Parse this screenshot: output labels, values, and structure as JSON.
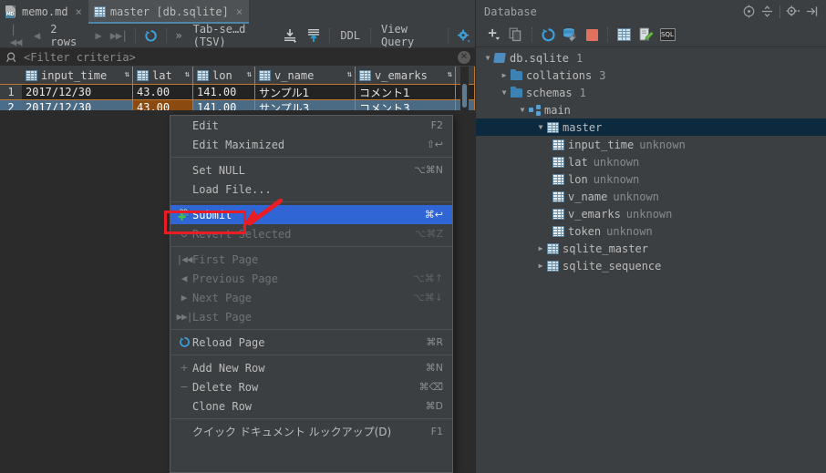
{
  "editor": {
    "tabs": [
      {
        "label": "memo.md",
        "icon": "markdown-file-icon",
        "active": false,
        "close": "×"
      },
      {
        "label": "master [db.sqlite]",
        "icon": "table-icon",
        "active": true,
        "close": "×"
      }
    ],
    "toolbar": {
      "first_page_icon": "first-page-icon",
      "prev_page_icon": "previous-page-icon",
      "rows_label": "2 rows",
      "next_page_icon": "next-page-icon",
      "last_page_icon": "last-page-icon",
      "reload_icon": "reload-icon",
      "chevrons_icon": "expand-chevrons-icon",
      "format_label": "Tab-se…d (TSV)",
      "dump_icon": "dump-data-icon",
      "upload_icon": "upload-data-icon",
      "ddl_label": "DDL",
      "view_query_label": "View Query",
      "settings_icon": "gear-icon"
    },
    "filter": {
      "icon": "search-icon",
      "placeholder": "<Filter criteria>",
      "clear_icon": "clear-icon"
    },
    "grid": {
      "columns": [
        {
          "name": "input_time",
          "icon": "column-icon",
          "sorter": "⇅"
        },
        {
          "name": "lat",
          "icon": "column-icon",
          "sorter": "⇅"
        },
        {
          "name": "lon",
          "icon": "column-icon",
          "sorter": "⇅"
        },
        {
          "name": "v_name",
          "icon": "column-icon",
          "sorter": "⇅"
        },
        {
          "name": "v_emarks",
          "icon": "column-icon",
          "sorter": "⇅"
        }
      ],
      "rows": [
        {
          "num": "1",
          "input_time": "2017/12/30",
          "lat": "43.00",
          "lon": "141.00",
          "v_name": "サンプル1",
          "v_emarks": "コメント1"
        },
        {
          "num": "2",
          "input_time": "2017/12/30",
          "lat": "43.00",
          "lon": "141.00",
          "v_name": "サンプル3",
          "v_emarks": "コメント3"
        }
      ]
    }
  },
  "context_menu": {
    "items": [
      {
        "label": "Edit",
        "shortcut": "F2",
        "icon": "",
        "state": "normal"
      },
      {
        "label": "Edit Maximized",
        "shortcut": "⇧↩",
        "icon": "",
        "state": "normal"
      },
      {
        "type": "separator"
      },
      {
        "label": "Set NULL",
        "shortcut": "⌥⌘N",
        "icon": "",
        "state": "normal"
      },
      {
        "label": "Load File...",
        "shortcut": "",
        "icon": "",
        "state": "normal"
      },
      {
        "type": "separator"
      },
      {
        "label": "Submit",
        "shortcut": "⌘↩",
        "icon": "db-submit-icon",
        "state": "selected"
      },
      {
        "label": "Revert Selected",
        "shortcut": "⌥⌘Z",
        "icon": "revert-icon",
        "state": "disabled"
      },
      {
        "type": "separator"
      },
      {
        "label": "First Page",
        "shortcut": "",
        "icon": "first-page-icon",
        "state": "disabled"
      },
      {
        "label": "Previous Page",
        "shortcut": "⌥⌘↑",
        "icon": "previous-page-icon",
        "state": "disabled"
      },
      {
        "label": "Next Page",
        "shortcut": "⌥⌘↓",
        "icon": "next-page-icon",
        "state": "disabled"
      },
      {
        "label": "Last Page",
        "shortcut": "",
        "icon": "last-page-icon",
        "state": "disabled"
      },
      {
        "type": "separator"
      },
      {
        "label": "Reload Page",
        "shortcut": "⌘R",
        "icon": "reload-icon",
        "state": "normal"
      },
      {
        "type": "separator"
      },
      {
        "label": "Add New Row",
        "shortcut": "⌘N",
        "icon": "plus-icon",
        "state": "normal"
      },
      {
        "label": "Delete Row",
        "shortcut": "⌘⌫",
        "icon": "minus-icon",
        "state": "normal"
      },
      {
        "label": "Clone Row",
        "shortcut": "⌘D",
        "icon": "",
        "state": "normal"
      },
      {
        "type": "separator"
      },
      {
        "label": "クイック ドキュメント ルックアップ(D)",
        "shortcut": "F1",
        "icon": "",
        "state": "normal",
        "japanese": true
      }
    ]
  },
  "annotation": {
    "highlight_color": "#ec1c24",
    "arrow_color": "#ec1c24",
    "target": "Submit"
  },
  "database_panel": {
    "title": "Database",
    "header_icons": [
      "locate-icon",
      "collapse-all-icon",
      "gear-dropdown-icon",
      "hide-panel-icon"
    ],
    "toolbar_icons": [
      "add-dropdown-icon",
      "copy-icon",
      "refresh-icon",
      "db-tools-icon",
      "stop-icon",
      "table-editor-icon",
      "modify-icon",
      "sql-console-icon"
    ],
    "tree": [
      {
        "depth": 0,
        "twisty": "▼",
        "icon": "sqlite-file-icon",
        "label": "db.sqlite",
        "count": "1",
        "type": "",
        "selected": false
      },
      {
        "depth": 1,
        "twisty": "▶",
        "icon": "folder-icon",
        "label": "collations",
        "count": "3",
        "type": "",
        "selected": false
      },
      {
        "depth": 1,
        "twisty": "▼",
        "icon": "folder-icon",
        "label": "schemas",
        "count": "1",
        "type": "",
        "selected": false
      },
      {
        "depth": 2,
        "twisty": "▼",
        "icon": "schema-icon",
        "label": "main",
        "count": "",
        "type": "",
        "selected": false
      },
      {
        "depth": 3,
        "twisty": "▼",
        "icon": "table-icon",
        "label": "master",
        "count": "",
        "type": "",
        "selected": true
      },
      {
        "depth": 4,
        "twisty": "",
        "icon": "column-icon",
        "label": "input_time",
        "count": "",
        "type": "unknown",
        "selected": false
      },
      {
        "depth": 4,
        "twisty": "",
        "icon": "column-icon",
        "label": "lat",
        "count": "",
        "type": "unknown",
        "selected": false
      },
      {
        "depth": 4,
        "twisty": "",
        "icon": "column-icon",
        "label": "lon",
        "count": "",
        "type": "unknown",
        "selected": false
      },
      {
        "depth": 4,
        "twisty": "",
        "icon": "column-icon",
        "label": "v_name",
        "count": "",
        "type": "unknown",
        "selected": false
      },
      {
        "depth": 4,
        "twisty": "",
        "icon": "column-icon",
        "label": "v_emarks",
        "count": "",
        "type": "unknown",
        "selected": false
      },
      {
        "depth": 4,
        "twisty": "",
        "icon": "column-icon",
        "label": "token",
        "count": "",
        "type": "unknown",
        "selected": false
      },
      {
        "depth": 3,
        "twisty": "▶",
        "icon": "table-icon",
        "label": "sqlite_master",
        "count": "",
        "type": "",
        "selected": false
      },
      {
        "depth": 3,
        "twisty": "▶",
        "icon": "table-icon",
        "label": "sqlite_sequence",
        "count": "",
        "type": "",
        "selected": false
      }
    ]
  },
  "colors": {
    "background": "#3c3f41",
    "editor_background": "#2b2b2b",
    "selection_blue": "#2f65d4",
    "row_selection": "#4b6a84",
    "edited_cell": "#8a4a10",
    "grid_border": "#c07830",
    "accent_blue": "#4e9ad4",
    "annotation_red": "#ec1c24"
  }
}
